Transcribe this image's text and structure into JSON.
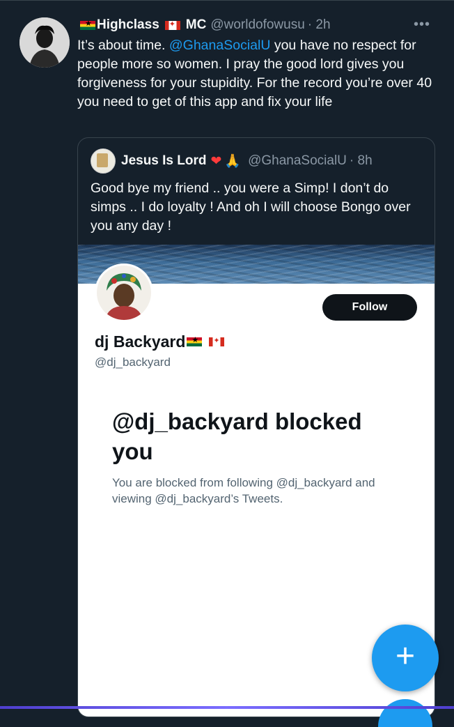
{
  "tweet": {
    "display_name_part1": "Highclass",
    "display_name_part2": "MC",
    "handle": "@worldofowusu",
    "time": "· 2h",
    "more_label": "•••",
    "text_before": "It’s about time. ",
    "mention": "@GhanaSocialU",
    "text_after": " you have no respect for people more so women. I pray the good lord gives you forgiveness for your stupidity.  For the record you’re over 40 you need to get of this app and fix your life"
  },
  "quote": {
    "display_name": "Jesus Is Lord",
    "heart": "❤",
    "pray": "🙏",
    "handle": "@GhanaSocialU",
    "time": "· 8h",
    "text": "Good bye my friend .. you were a Simp! I don’t do simps .. I do loyalty ! And oh I will choose Bongo over you any day !"
  },
  "profile": {
    "name": "dj Backyard",
    "handle": "@dj_backyard",
    "follow_label": "Follow",
    "blocked_title": "@dj_backyard blocked you",
    "blocked_desc": "You are blocked from following @dj_backyard and viewing @dj_backyard’s Tweets."
  },
  "fab": {
    "label": "+"
  },
  "icons": {
    "flags": [
      "ghana-flag-icon",
      "canada-flag-icon"
    ],
    "more": "more-options-icon",
    "compose": "compose-plus-icon"
  },
  "colors": {
    "background": "#15202b",
    "accent": "#1d9bf0",
    "text": "#f7f9f9",
    "muted": "#8b98a5",
    "border": "#38444d"
  }
}
